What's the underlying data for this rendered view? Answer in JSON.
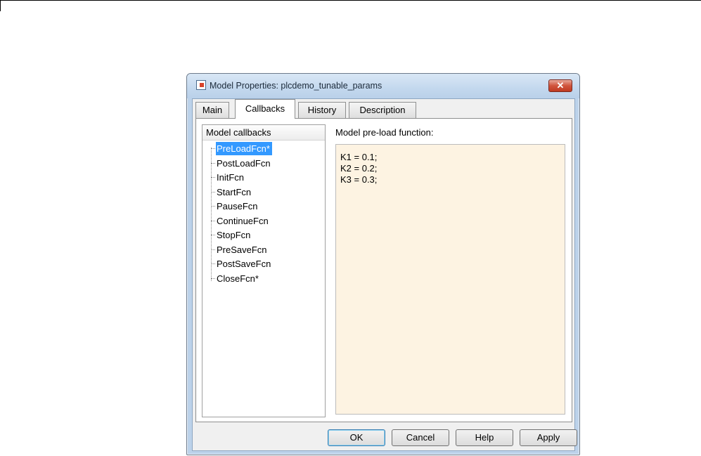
{
  "window": {
    "title": "Model Properties: plcdemo_tunable_params",
    "close_glyph": "✕",
    "icon": "simulink-model-icon"
  },
  "tabs": [
    {
      "label": "Main",
      "active": false
    },
    {
      "label": "Callbacks",
      "active": true
    },
    {
      "label": "History",
      "active": false
    },
    {
      "label": "Description",
      "active": false
    }
  ],
  "tree": {
    "header": "Model callbacks",
    "items": [
      {
        "label": "PreLoadFcn*",
        "selected": true
      },
      {
        "label": "PostLoadFcn",
        "selected": false
      },
      {
        "label": "InitFcn",
        "selected": false
      },
      {
        "label": "StartFcn",
        "selected": false
      },
      {
        "label": "PauseFcn",
        "selected": false
      },
      {
        "label": "ContinueFcn",
        "selected": false
      },
      {
        "label": "StopFcn",
        "selected": false
      },
      {
        "label": "PreSaveFcn",
        "selected": false
      },
      {
        "label": "PostSaveFcn",
        "selected": false
      },
      {
        "label": "CloseFcn*",
        "selected": false
      }
    ]
  },
  "editor": {
    "label": "Model pre-load function:",
    "lines": [
      "K1 = 0.1;",
      "K2 = 0.2;",
      "K3 = 0.3;"
    ]
  },
  "buttons": {
    "ok": "OK",
    "cancel": "Cancel",
    "help": "Help",
    "apply": "Apply"
  },
  "colors": {
    "selection": "#3399ff",
    "editor_background": "#fdf3e2",
    "close_button": "#c03a22"
  }
}
